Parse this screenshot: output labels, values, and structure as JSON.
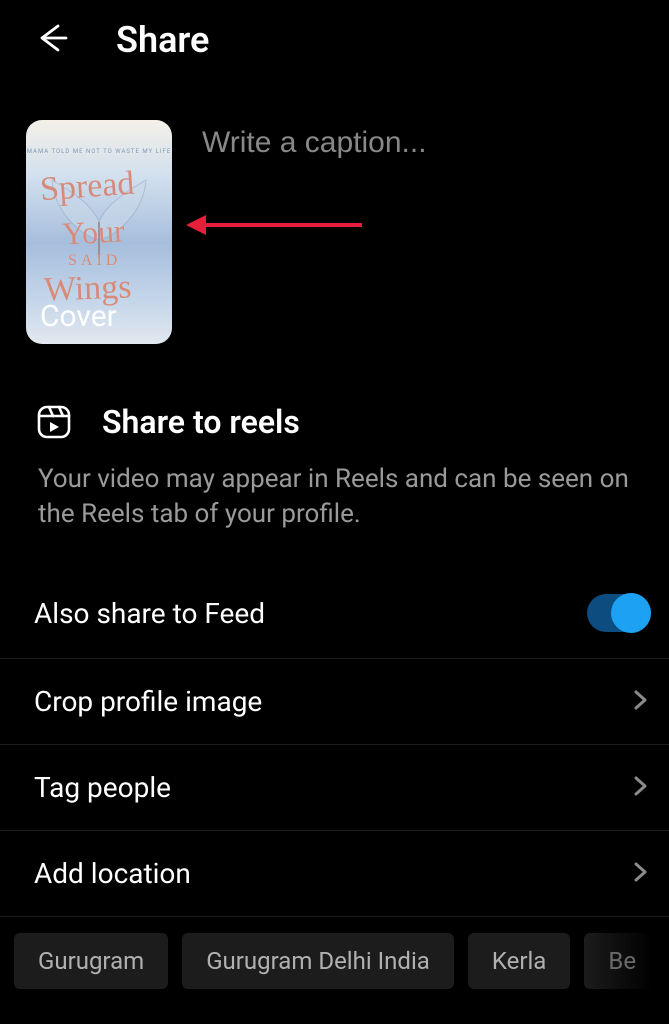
{
  "header": {
    "title": "Share"
  },
  "caption": {
    "placeholder": "Write a caption...",
    "cover_label": "Cover",
    "cover_art": {
      "tiny": "MAMA TOLD ME NOT TO WASTE MY LIFE",
      "line1": "Spread",
      "line2": "Your",
      "said": "SAID",
      "line3": "Wings"
    }
  },
  "reels": {
    "title": "Share to reels",
    "description": "Your video may appear in Reels and can be seen on the Reels tab of your profile."
  },
  "options": {
    "feed": "Also share to Feed",
    "feed_on": true,
    "crop": "Crop profile image",
    "tag": "Tag people",
    "location": "Add location"
  },
  "location_chips": [
    "Gurugram",
    "Gurugram Delhi India",
    "Kerla",
    "Be"
  ]
}
